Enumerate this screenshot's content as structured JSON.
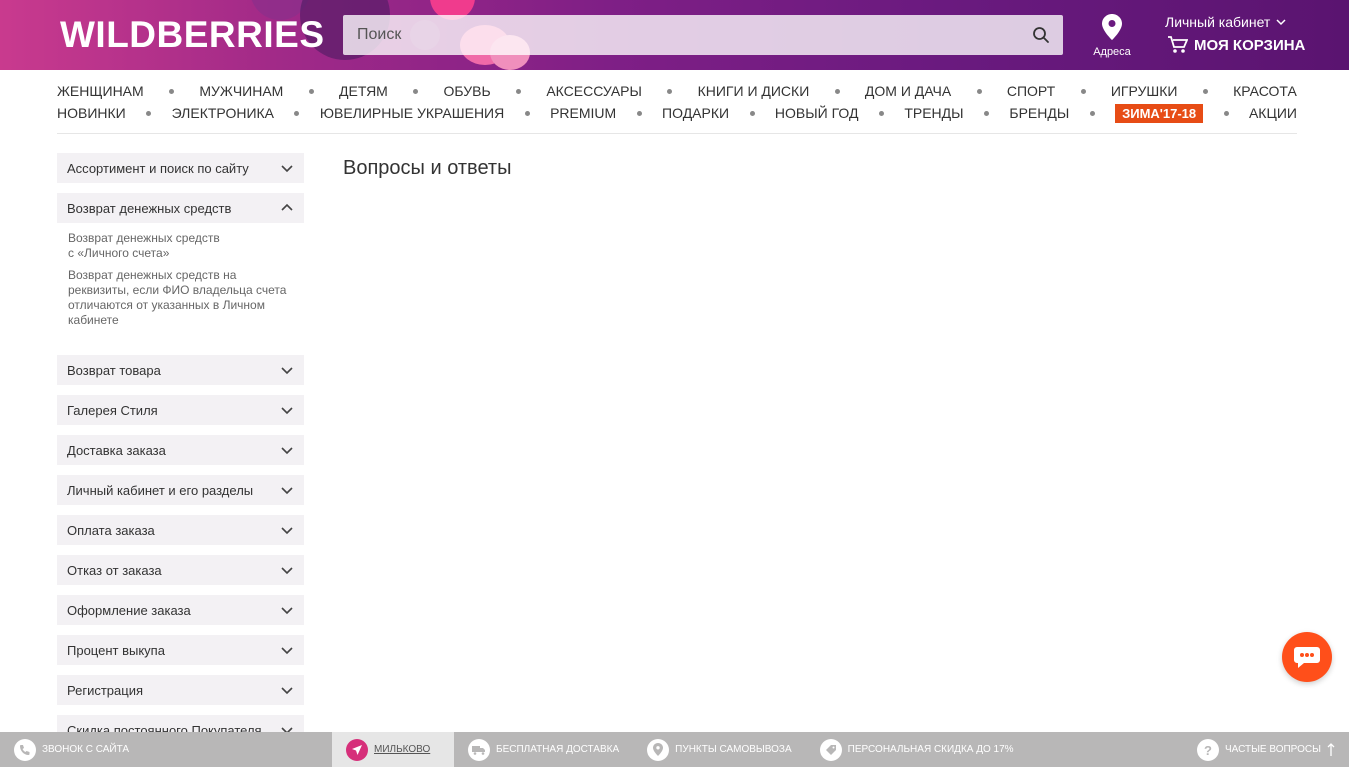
{
  "header": {
    "logo": "WILDBERRIES",
    "search_placeholder": "Поиск",
    "address_label": "Адреса",
    "cabinet_label": "Личный кабинет",
    "cart_label": "МОЯ КОРЗИНА"
  },
  "nav": {
    "row1": [
      "ЖЕНЩИНАМ",
      "МУЖЧИНАМ",
      "ДЕТЯМ",
      "ОБУВЬ",
      "АКСЕССУАРЫ",
      "КНИГИ И ДИСКИ",
      "ДОМ И ДАЧА",
      "СПОРТ",
      "ИГРУШКИ",
      "КРАСОТА"
    ],
    "row2": [
      "НОВИНКИ",
      "ЭЛЕКТРОНИКА",
      "ЮВЕЛИРНЫЕ УКРАШЕНИЯ",
      "PREMIUM",
      "ПОДАРКИ",
      "НОВЫЙ ГОД",
      "ТРЕНДЫ",
      "БРЕНДЫ",
      "ЗИМА'17-18",
      "АКЦИИ"
    ]
  },
  "sidebar": {
    "sections": [
      {
        "label": "Ассортимент и поиск по сайту"
      },
      {
        "label": "Возврат денежных средств",
        "open": true,
        "items": [
          "Возврат денежных средств\nс «Личного счета»",
          "Возврат денежных средств на реквизиты, если ФИО владельца счета отличаются от указанных в Личном кабинете"
        ]
      },
      {
        "label": "Возврат товара"
      },
      {
        "label": "Галерея Стиля"
      },
      {
        "label": "Доставка заказа"
      },
      {
        "label": "Личный кабинет и его разделы"
      },
      {
        "label": "Оплата заказа"
      },
      {
        "label": "Отказ от заказа"
      },
      {
        "label": "Оформление заказа"
      },
      {
        "label": "Процент выкупа"
      },
      {
        "label": "Регистрация"
      },
      {
        "label": "Скидка постоянного Покупателя"
      }
    ]
  },
  "main": {
    "title": "Вопросы и ответы"
  },
  "footer": {
    "call": "Звонок с сайта",
    "city": "Мильково",
    "delivery": "Бесплатная доставка",
    "pickup": "Пункты самовывоза",
    "discount": "Персональная скидка до 17%",
    "faq": "Частые вопросы"
  },
  "colors": {
    "brand": "#7f1f86",
    "hot": "#e74c15",
    "chat": "#ff4f1a"
  }
}
